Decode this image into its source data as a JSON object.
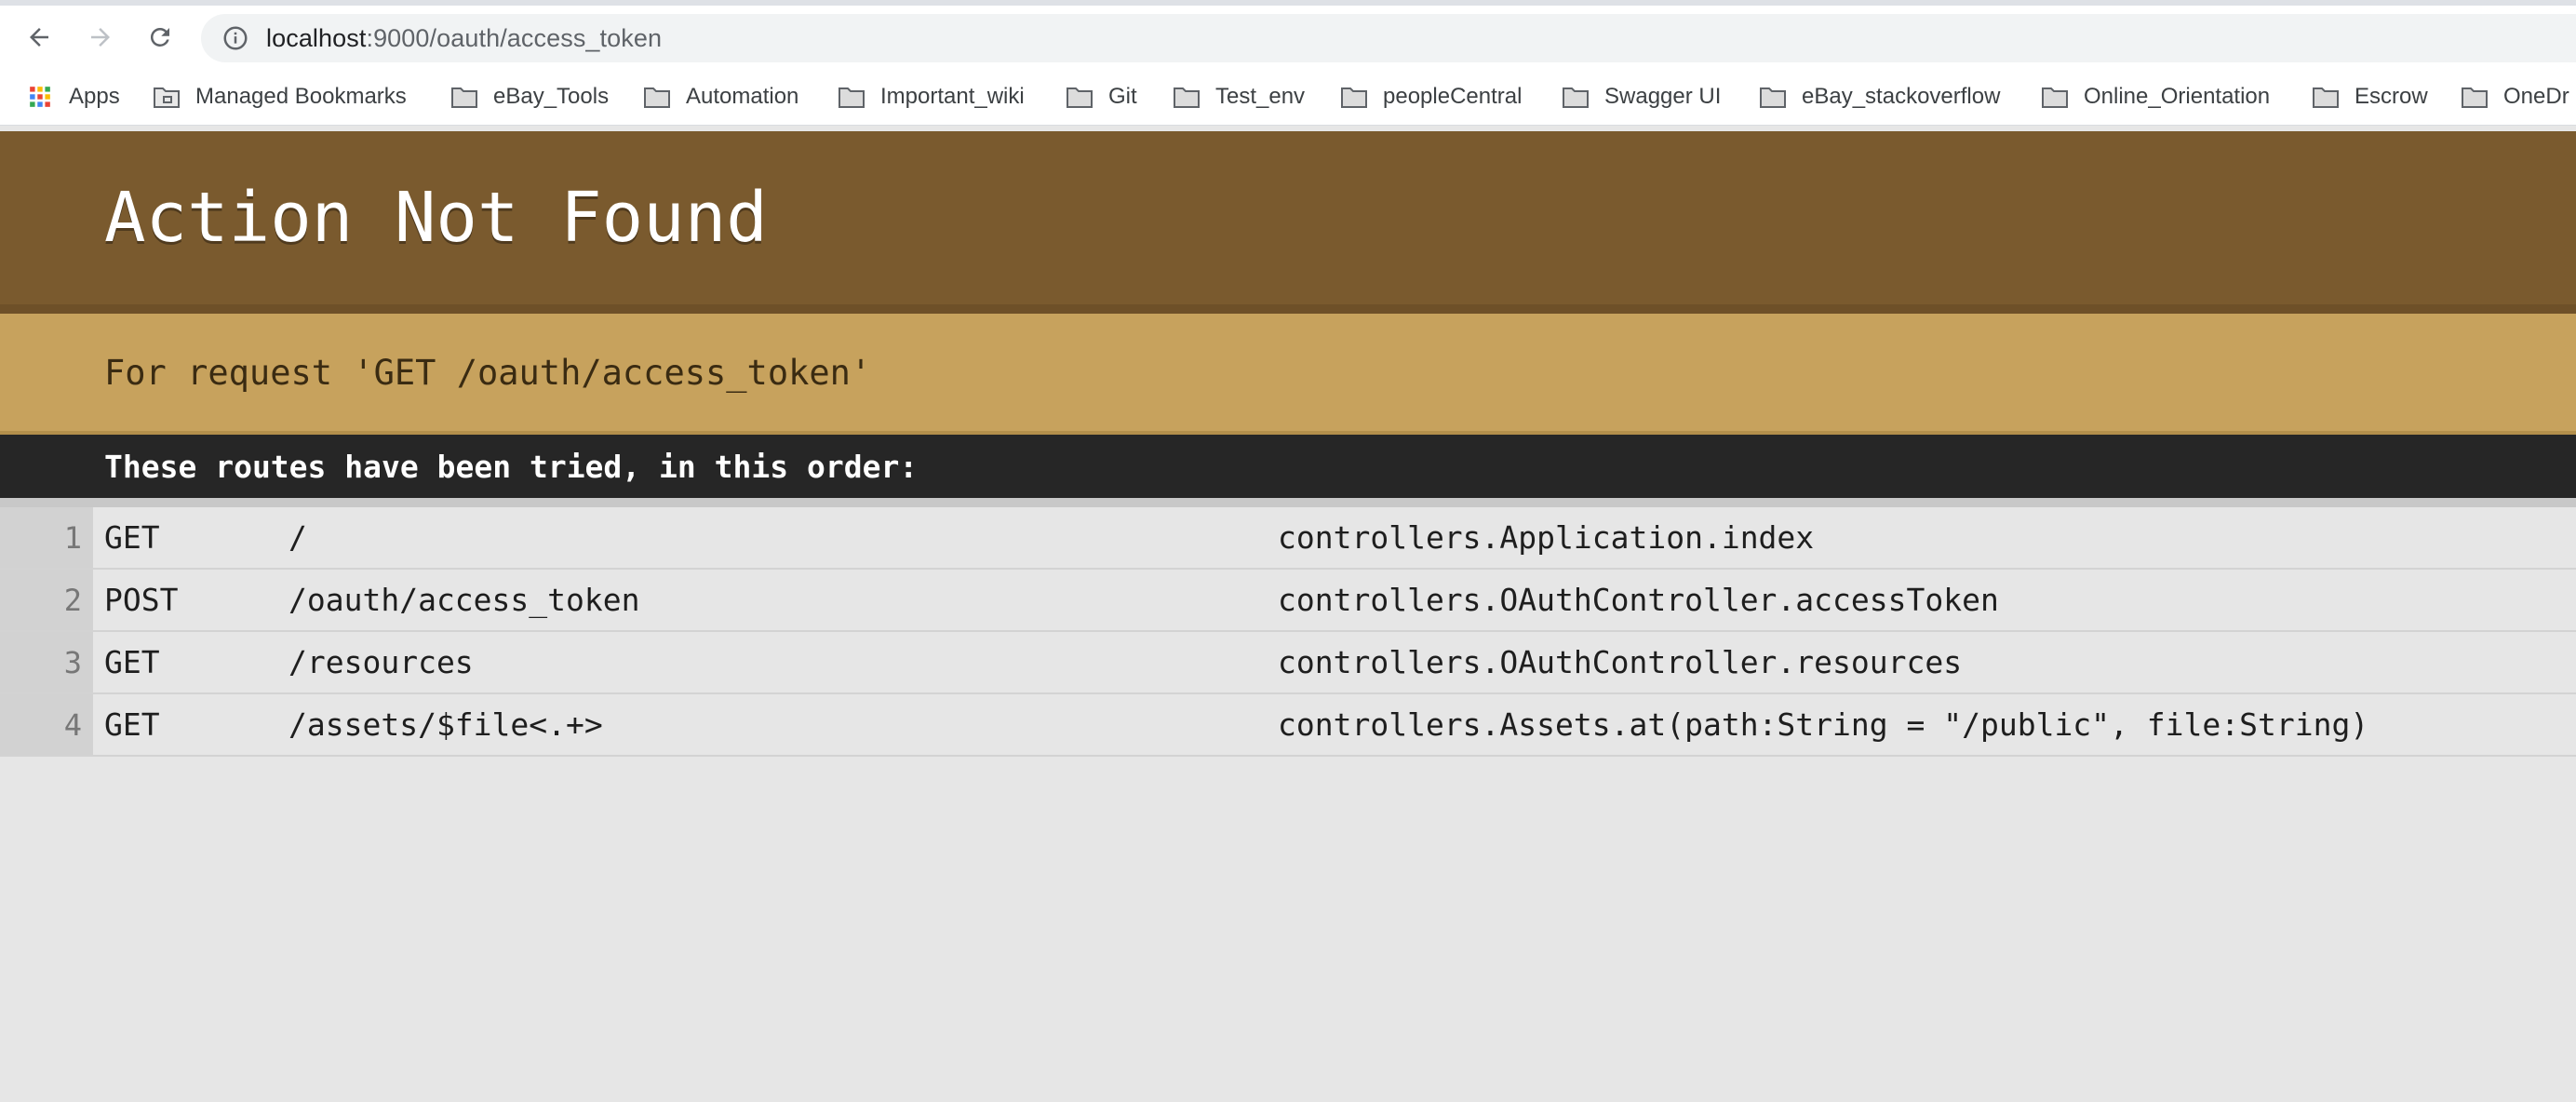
{
  "browser": {
    "url_host": "localhost",
    "url_path": ":9000/oauth/access_token",
    "bookmarks": [
      {
        "label": "Apps",
        "icon": "apps-grid-icon"
      },
      {
        "label": "Managed Bookmarks",
        "icon": "managed-folder-icon"
      },
      {
        "label": "eBay_Tools",
        "icon": "folder-icon"
      },
      {
        "label": "Automation",
        "icon": "folder-icon"
      },
      {
        "label": "Important_wiki",
        "icon": "folder-icon"
      },
      {
        "label": "Git",
        "icon": "folder-icon"
      },
      {
        "label": "Test_env",
        "icon": "folder-icon"
      },
      {
        "label": "peopleCentral",
        "icon": "folder-icon"
      },
      {
        "label": "Swagger UI",
        "icon": "folder-icon"
      },
      {
        "label": "eBay_stackoverflow",
        "icon": "folder-icon"
      },
      {
        "label": "Online_Orientation",
        "icon": "folder-icon"
      },
      {
        "label": "Escrow",
        "icon": "folder-icon"
      },
      {
        "label": "OneDr",
        "icon": "folder-icon"
      }
    ]
  },
  "page": {
    "title": "Action Not Found",
    "request": "For request 'GET /oauth/access_token'",
    "routes_heading": "These routes have been tried, in this order:",
    "routes": [
      {
        "num": "1",
        "method": "GET",
        "path": "/",
        "action": "controllers.Application.index"
      },
      {
        "num": "2",
        "method": "POST",
        "path": "/oauth/access_token",
        "action": "controllers.OAuthController.accessToken"
      },
      {
        "num": "3",
        "method": "GET",
        "path": "/resources",
        "action": "controllers.OAuthController.resources"
      },
      {
        "num": "4",
        "method": "GET",
        "path": "/assets/$file<.+>",
        "action": "controllers.Assets.at(path:String = \"/public\", file:String)"
      }
    ]
  },
  "colors": {
    "header": "#7a5a2e",
    "request_band": "#c7a25d",
    "routes_header": "#262626",
    "page_bg": "#e6e6e6"
  }
}
